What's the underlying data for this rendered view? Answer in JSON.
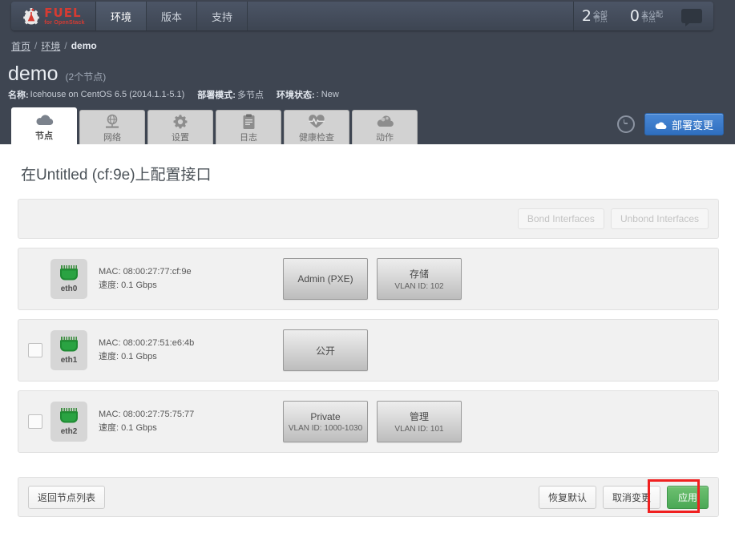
{
  "navbar": {
    "brand": {
      "title": "FUEL",
      "subtitle": "for OpenStack",
      "icon": "fuel-flask-icon"
    },
    "items": [
      {
        "label": "环境",
        "active": true
      },
      {
        "label": "版本",
        "active": false
      },
      {
        "label": "支持",
        "active": false
      }
    ],
    "stats": [
      {
        "count": "2",
        "line1": "全部",
        "line2": "节点"
      },
      {
        "count": "0",
        "line1": "未分配",
        "line2": "节点"
      }
    ],
    "chat_icon": "chat-bubble-icon"
  },
  "breadcrumb": {
    "home": "首页",
    "env": "环境",
    "current": "demo",
    "separator": "/"
  },
  "cluster": {
    "name": "demo",
    "nodes_count": "(2个节点)",
    "meta": {
      "name_key": "名称:",
      "name_value": "Icehouse on CentOS 6.5 (2014.1.1-5.1)",
      "mode_key": "部署模式:",
      "mode_value": "多节点",
      "status_key": "环境状态:",
      "status_value": ": New"
    }
  },
  "tabs": [
    {
      "label": "节点",
      "icon": "cloud-icon",
      "active": true
    },
    {
      "label": "网络",
      "icon": "globe-network-icon",
      "active": false
    },
    {
      "label": "设置",
      "icon": "gear-icon",
      "active": false
    },
    {
      "label": "日志",
      "icon": "clipboard-icon",
      "active": false
    },
    {
      "label": "健康检查",
      "icon": "heartbeat-icon",
      "active": false
    },
    {
      "label": "动作",
      "icon": "actions-cloud-icon",
      "active": false
    }
  ],
  "deploy": {
    "history_icon": "history-clock-icon",
    "button_label": "部署变更",
    "button_icon": "cloud-upload-icon",
    "button_color": "#3a7bcf"
  },
  "main": {
    "title": "在Untitled (cf:9e)上配置接口",
    "bond_bar": {
      "bond_label": "Bond Interfaces",
      "unbond_label": "Unbond Interfaces",
      "bond_disabled": true,
      "unbond_disabled": true
    },
    "interfaces": [
      {
        "name": "eth0",
        "checkbox": false,
        "mac_label": "MAC:",
        "mac": "08:00:27:77:cf:9e",
        "speed_label": "速度:",
        "speed": "0.1 Gbps",
        "networks": [
          {
            "name": "Admin (PXE)",
            "vlan": ""
          },
          {
            "name": "存储",
            "vlan": "VLAN ID: 102"
          }
        ]
      },
      {
        "name": "eth1",
        "checkbox": true,
        "mac_label": "MAC:",
        "mac": "08:00:27:51:e6:4b",
        "speed_label": "速度:",
        "speed": "0.1 Gbps",
        "networks": [
          {
            "name": "公开",
            "vlan": ""
          }
        ]
      },
      {
        "name": "eth2",
        "checkbox": true,
        "mac_label": "MAC:",
        "mac": "08:00:27:75:75:77",
        "speed_label": "速度:",
        "speed": "0.1 Gbps",
        "networks": [
          {
            "name": "Private",
            "vlan": "VLAN ID: 1000-1030"
          },
          {
            "name": "管理",
            "vlan": "VLAN ID: 101"
          }
        ]
      }
    ],
    "footer": {
      "back_label": "返回节点列表",
      "defaults_label": "恢复默认",
      "cancel_label": "取消变更",
      "apply_label": "应用",
      "apply_color": "#5cb85c",
      "annotation_color": "#f02020"
    }
  }
}
